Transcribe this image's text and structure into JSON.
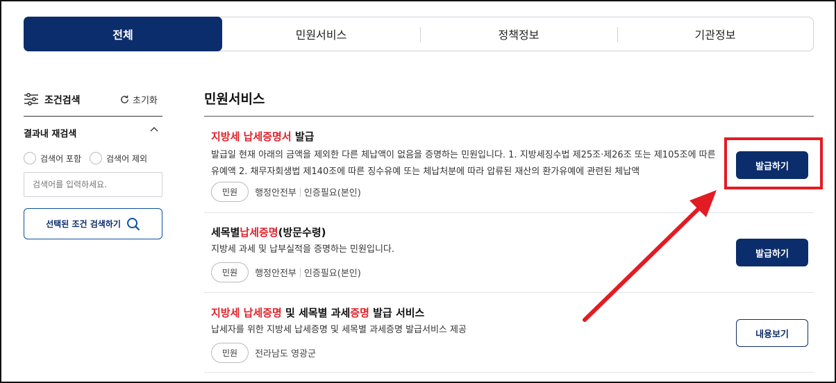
{
  "tabs": [
    {
      "label": "전체",
      "active": true
    },
    {
      "label": "민원서비스",
      "active": false
    },
    {
      "label": "정책정보",
      "active": false
    },
    {
      "label": "기관정보",
      "active": false
    }
  ],
  "sidebar": {
    "title": "조건검색",
    "reset_label": "초기화",
    "subsection_title": "결과내 재검색",
    "radio_include": "검색어 포함",
    "radio_exclude": "검색어 제외",
    "search_placeholder": "검색어를 입력하세요.",
    "search_button": "선택된 조건 검색하기"
  },
  "main": {
    "section_title": "민원서비스",
    "items": [
      {
        "title_parts": [
          {
            "text": "지방세 납세증명서",
            "red": true
          },
          {
            "text": " 발급",
            "red": false
          }
        ],
        "description": "발급일 현재 아래의 금액을 제외한 다른 체납액이 없음을 증명하는 민원입니다. 1. 지방세징수법 제25조·제26조 또는 제105조에 따른 유예액 2. 채무자회생법 제140조에 따른 징수유예 또는 체납처분에 따라 압류된 재산의 환가유예에 관련된 체납액",
        "tag": "민원",
        "agency": "행정안전부",
        "auth": "인증필요(본인)",
        "button": "발급하기",
        "button_style": "dark"
      },
      {
        "title_parts": [
          {
            "text": "세목별",
            "red": false
          },
          {
            "text": "납세증명",
            "red": true
          },
          {
            "text": "(방문수령)",
            "red": false
          }
        ],
        "description": "지방세 과세 및 납부실적을 증명하는 민원입니다.",
        "tag": "민원",
        "agency": "행정안전부",
        "auth": "인증필요(본인)",
        "button": "발급하기",
        "button_style": "dark"
      },
      {
        "title_parts": [
          {
            "text": "지방세 납세증명",
            "red": true
          },
          {
            "text": " 및 세목별 과세",
            "red": false
          },
          {
            "text": "증명",
            "red": true
          },
          {
            "text": " 발급 서비스",
            "red": false
          }
        ],
        "description": "납세자를 위한 지방세 납세증명 및 세목별 과세증명 발급서비스 제공",
        "tag": "민원",
        "agency": "전라남도 영광군",
        "auth": "",
        "button": "내용보기",
        "button_style": "outline"
      }
    ]
  },
  "colors": {
    "brand_navy": "#0c2d6b",
    "highlight_red": "#e31b23",
    "title_red": "#e0202a"
  }
}
